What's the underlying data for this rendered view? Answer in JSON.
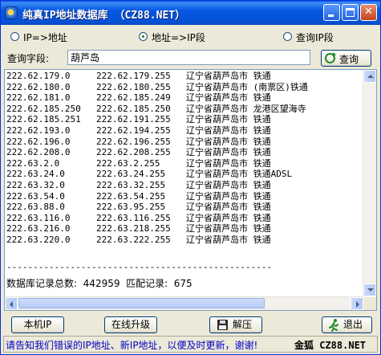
{
  "window": {
    "title": "纯真IP地址数据库 （CZ88.NET）"
  },
  "modes": [
    {
      "label": "IP=>地址",
      "selected": false
    },
    {
      "label": "地址=>IP段",
      "selected": true
    },
    {
      "label": "查询IP段",
      "selected": false
    }
  ],
  "query": {
    "label": "查询字段:",
    "value": "葫芦岛",
    "button_label": "查询"
  },
  "results": {
    "rows": [
      {
        "start": "222.62.179.0",
        "end": "222.62.179.255",
        "location": "辽宁省葫芦岛市 铁通"
      },
      {
        "start": "222.62.180.0",
        "end": "222.62.180.255",
        "location": "辽宁省葫芦岛市 (南票区)铁通"
      },
      {
        "start": "222.62.181.0",
        "end": "222.62.185.249",
        "location": "辽宁省葫芦岛市 铁通"
      },
      {
        "start": "222.62.185.250",
        "end": "222.62.185.250",
        "location": "辽宁省葫芦岛市 龙港区望海寺"
      },
      {
        "start": "222.62.185.251",
        "end": "222.62.191.255",
        "location": "辽宁省葫芦岛市 铁通"
      },
      {
        "start": "222.62.193.0",
        "end": "222.62.194.255",
        "location": "辽宁省葫芦岛市 铁通"
      },
      {
        "start": "222.62.196.0",
        "end": "222.62.196.255",
        "location": "辽宁省葫芦岛市 铁通"
      },
      {
        "start": "222.62.208.0",
        "end": "222.62.208.255",
        "location": "辽宁省葫芦岛市 铁通"
      },
      {
        "start": "222.63.2.0",
        "end": "222.63.2.255",
        "location": "辽宁省葫芦岛市 铁通"
      },
      {
        "start": "222.63.24.0",
        "end": "222.63.24.255",
        "location": "辽宁省葫芦岛市 铁通ADSL"
      },
      {
        "start": "222.63.32.0",
        "end": "222.63.32.255",
        "location": "辽宁省葫芦岛市 铁通"
      },
      {
        "start": "222.63.54.0",
        "end": "222.63.54.255",
        "location": "辽宁省葫芦岛市 铁通"
      },
      {
        "start": "222.63.88.0",
        "end": "222.63.95.255",
        "location": "辽宁省葫芦岛市 铁通"
      },
      {
        "start": "222.63.116.0",
        "end": "222.63.116.255",
        "location": "辽宁省葫芦岛市 铁通"
      },
      {
        "start": "222.63.216.0",
        "end": "222.63.218.255",
        "location": "辽宁省葫芦岛市 铁通"
      },
      {
        "start": "222.63.220.0",
        "end": "222.63.222.255",
        "location": "辽宁省葫芦岛市 铁通"
      }
    ],
    "separator": "--------------------------------------------------",
    "stats": "数据库记录总数:  442959  匹配记录:  675"
  },
  "buttons": {
    "local_ip": "本机IP",
    "online_upgrade": "在线升级",
    "unzip": "解压",
    "exit": "退出"
  },
  "status": {
    "message": "请告知我们错误的IP地址、新IP地址，以便及时更新，谢谢!",
    "brand": "金狐 CZ88.NET"
  }
}
